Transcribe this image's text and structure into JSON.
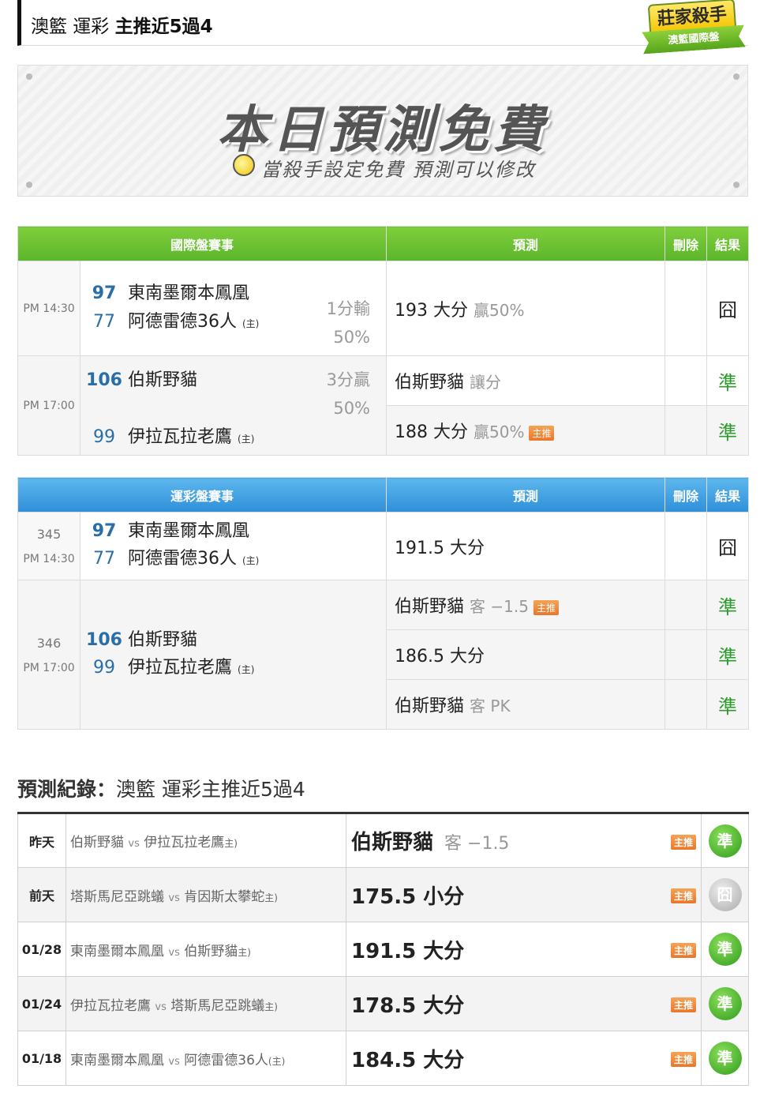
{
  "header": {
    "title_part1": "澳籃 運彩",
    "title_part2": "主推近5過4",
    "badge_top": "莊家殺手",
    "badge_bottom": "澳籃國際盤"
  },
  "banner": {
    "main": "本日預測免費",
    "sub": "當殺手設定免費 預測可以修改"
  },
  "intl": {
    "headers": {
      "match": "國際盤賽事",
      "predict": "預測",
      "delete": "刪除",
      "result": "結果"
    },
    "games": [
      {
        "time": "PM 14:30",
        "away_score": "97",
        "away": "東南墨爾本鳳凰",
        "home_score": "77",
        "home": "阿德雷德36人",
        "home_tag": "(主)",
        "handicap_1": "1分輸",
        "handicap_2": "50%",
        "pred_main": "193 大分",
        "pred_muted": "贏50%",
        "result": "囧"
      },
      {
        "time": "PM 17:00",
        "away_score": "106",
        "away": "伯斯野貓",
        "home_score": "99",
        "home": "伊拉瓦拉老鷹",
        "home_tag": "(主)",
        "handicap_1": "3分贏",
        "handicap_2": "50%",
        "pred1_main": "伯斯野貓",
        "pred1_muted": "讓分",
        "result1": "準",
        "pred2_main": "188 大分",
        "pred2_muted": "贏50%",
        "pred2_tag": "主推",
        "result2": "準"
      }
    ]
  },
  "sport": {
    "headers": {
      "match": "運彩盤賽事",
      "predict": "預測",
      "delete": "刪除",
      "result": "結果"
    },
    "games": [
      {
        "num": "345",
        "time": "PM 14:30",
        "away_score": "97",
        "away": "東南墨爾本鳳凰",
        "home_score": "77",
        "home": "阿德雷德36人",
        "home_tag": "(主)",
        "pred_main": "191.5 大分",
        "result": "囧"
      },
      {
        "num": "346",
        "time": "PM 17:00",
        "away_score": "106",
        "away": "伯斯野貓",
        "home_score": "99",
        "home": "伊拉瓦拉老鷹",
        "home_tag": "(主)",
        "pred1_main": "伯斯野貓",
        "pred1_muted": "客 −1.5",
        "pred1_tag": "主推",
        "result1": "準",
        "pred2_main": "186.5 大分",
        "result2": "準",
        "pred3_main": "伯斯野貓",
        "pred3_muted": "客 PK",
        "result3": "準"
      }
    ]
  },
  "record": {
    "title_bold": "預測紀錄：",
    "title_rest": "澳籃 運彩主推近5過4",
    "rows": [
      {
        "date": "昨天",
        "away": "伯斯野貓",
        "vs": "vs",
        "home": "伊拉瓦拉老鷹",
        "h": "主)",
        "pick": "伯斯野貓",
        "pick_muted": "客 −1.5",
        "tag": "主推",
        "result": "準",
        "status": "win"
      },
      {
        "date": "前天",
        "away": "塔斯馬尼亞跳蟻",
        "vs": "vs",
        "home": "肯因斯太攀蛇",
        "h": "主)",
        "pick": "175.5 小分",
        "pick_muted": "",
        "tag": "主推",
        "result": "囧",
        "status": "push"
      },
      {
        "date": "01/28",
        "away": "東南墨爾本鳳凰",
        "vs": "vs",
        "home": "伯斯野貓",
        "h": "主)",
        "pick": "191.5 大分",
        "pick_muted": "",
        "tag": "主推",
        "result": "準",
        "status": "win"
      },
      {
        "date": "01/24",
        "away": "伊拉瓦拉老鷹",
        "vs": "vs",
        "home": "塔斯馬尼亞跳蟻",
        "h": "主)",
        "pick": "178.5 大分",
        "pick_muted": "",
        "tag": "主推",
        "result": "準",
        "status": "win"
      },
      {
        "date": "01/18",
        "away": "東南墨爾本鳳凰",
        "vs": "vs",
        "home": "阿德雷德36人",
        "h": "(主)",
        "pick": "184.5 大分",
        "pick_muted": "",
        "tag": "主推",
        "result": "準",
        "status": "win"
      }
    ]
  }
}
